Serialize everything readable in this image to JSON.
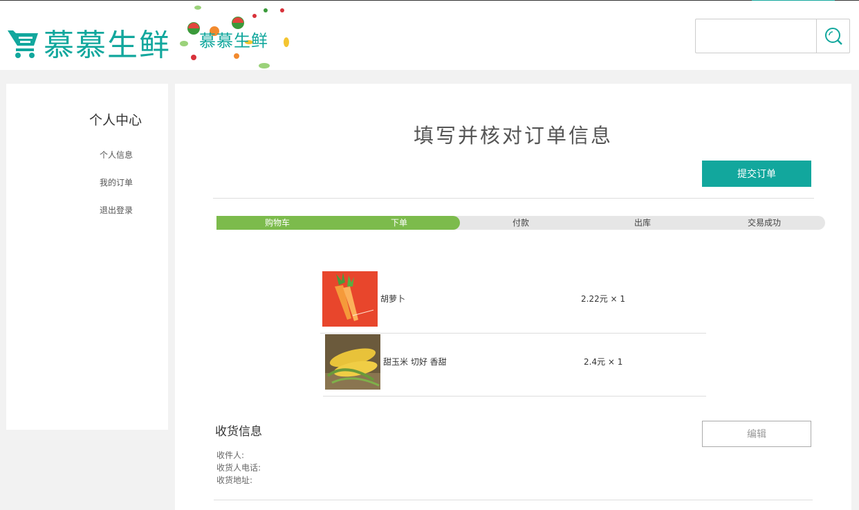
{
  "header": {
    "logo_text": "慕慕生鲜",
    "logo2_text": "慕慕生鲜",
    "search": {
      "value": "",
      "placeholder": ""
    }
  },
  "sidebar": {
    "title": "个人中心",
    "items": [
      {
        "label": "个人信息"
      },
      {
        "label": "我的订单"
      },
      {
        "label": "退出登录"
      }
    ]
  },
  "main": {
    "title": "填写并核对订单信息",
    "submit_label": "提交订单",
    "progress": {
      "steps": [
        "购物车",
        "下单",
        "付款",
        "出库",
        "交易成功"
      ],
      "completed_steps": 2
    },
    "items": [
      {
        "name": "胡萝卜",
        "price": "2.22元 × 1"
      },
      {
        "name": "甜玉米 切好 香甜",
        "price": "2.4元 × 1"
      }
    ],
    "shipping": {
      "title": "收货信息",
      "edit_label": "编辑",
      "receiver_label": "收件人:",
      "phone_label": "收货人电话:",
      "address_label": "收货地址:"
    }
  },
  "colors": {
    "accent": "#12a79d",
    "progress_done": "#7cbb4c",
    "progress_todo": "#e6e6e6",
    "carrot_bg": "#e8462c"
  }
}
